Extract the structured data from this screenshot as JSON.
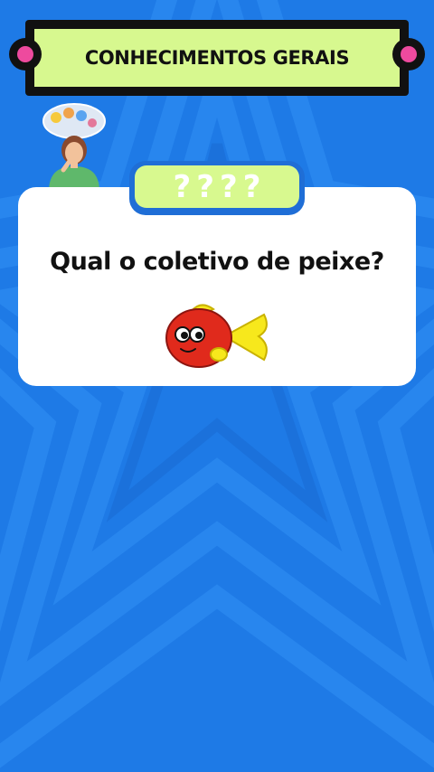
{
  "header": {
    "title": "CONHECIMENTOS GERAIS"
  },
  "answer_slot": {
    "placeholder": "????"
  },
  "question": {
    "text": "Qual o coletivo de peixe?"
  },
  "icons": {
    "banner_bolts": "circle-bolt-icon",
    "character": "thinking-woman-icon",
    "question_image": "fish-icon"
  },
  "colors": {
    "background": "#1e7ae6",
    "banner": "#d7f88f",
    "accent_pink": "#ee4a9e",
    "fish_red": "#e02a1c",
    "fish_yellow": "#f7e81c"
  }
}
